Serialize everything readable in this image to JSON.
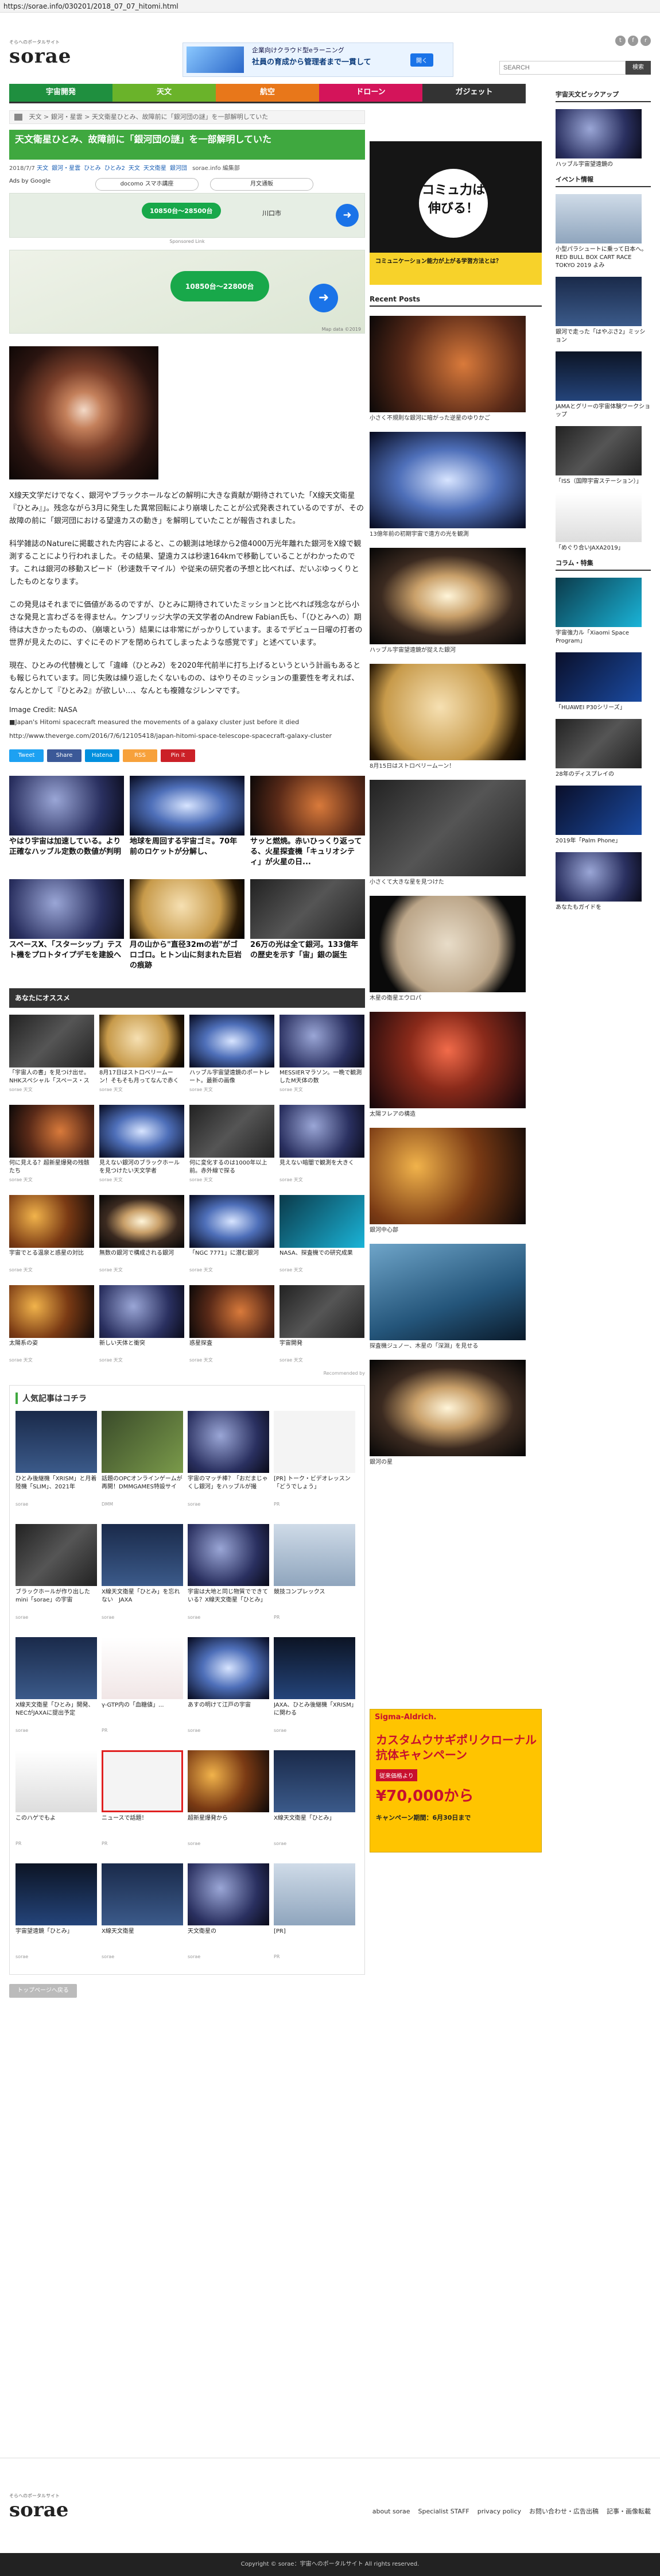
{
  "url": "https://sorae.info/030201/2018_07_07_hitomi.html",
  "site": {
    "tagline": "そらへのポータルサイト",
    "name": "sorae"
  },
  "top_ad": {
    "line1": "企業向けクラウド型eラーニング",
    "line2": "社員の育成から管理者まで一貫して",
    "button": "開く"
  },
  "search": {
    "placeholder": "SEARCH",
    "button": "検索"
  },
  "nav": [
    {
      "label": "宇宙開発",
      "color": "#1f8f3f"
    },
    {
      "label": "天文",
      "color": "#6ab32a"
    },
    {
      "label": "航空",
      "color": "#e8771a"
    },
    {
      "label": "ドローン",
      "color": "#d4145a"
    },
    {
      "label": "ガジェット",
      "color": "#333333"
    }
  ],
  "breadcrumb": [
    "天文",
    "銀河・星雲",
    "天文衛星ひとみ、故障前に「銀河団の謎」を一部解明していた"
  ],
  "article": {
    "title": "天文衛星ひとみ、故障前に「銀河団の謎」を一部解明していた",
    "date": "2018/7/7",
    "tags": [
      "天文",
      "銀河・星雲",
      "ひとみ",
      "ひとみ2",
      "天文",
      "天文衛星",
      "銀河団"
    ],
    "author": "sorae.info 編集部",
    "ads_label": "Ads by Google",
    "ads_pill1": "docomo スマホ講座",
    "ads_pill2": "月文通販",
    "map1": {
      "price": "10850台～28500台",
      "loc": "川口市"
    },
    "sponsored": "Sponsored Link",
    "map2": {
      "price": "10850台～22800台",
      "credit": "Map data ©2019"
    },
    "paragraphs": [
      "X線天文学だけでなく、銀河やブラックホールなどの解明に大きな貢献が期待されていた「X線天文衛星『ひとみ』」。残念ながら3月に発生した異常回転により崩壊したことが公式発表されているのですが、その故障の前に「銀河団における望遠カスの動き」を解明していたことが報告されました。",
      "科学雑誌のNatureに掲載された内容によると、この観測は地球から2億4000万光年離れた銀河をX線で観測することにより行われました。その結果、望遠カスは秒速164kmで移動していることがわかったのです。これは銀河の移動スピード（秒速数千マイル）や従来の研究者の予想と比べれば、だいぶゆっくりとしたものとなります。",
      "この発見はそれまでに価値があるのですが、ひとみに期待されていたミッションと比べれば残念ながら小さな発見と言わざるを得ません。ケンブリッジ大学の天文学者のAndrew Fabian氏も、「（ひとみへの）期待は大きかったものの、（崩壊という）結果には非常にがっかりしています。まるでデビュー日曜の打者の世界が見えたのに、すぐにそのドアを閉められてしまったような感覚です」と述べています。",
      "現在、ひとみの代替機として「違峰（ひとみ2）を2020年代前半に打ち上げるというという計画もあるとも報じられています。同じ失敗は繰り返したくないものの、はやりそのミッションの重要性を考えれば、なんとかして『ひとみ2』が欲しい…、なんとも複雑なジレンマです。"
    ],
    "image_credit": "Image Credit: NASA",
    "source_line1": "■Japan's Hitomi spacecraft measured the movements of a galaxy cluster just before it died",
    "source_line2": "http://www.theverge.com/2016/7/6/12105418/japan-hitomi-space-telescope-spacecraft-galaxy-cluster",
    "share": [
      {
        "label": "Tweet",
        "color": "#1da1f2"
      },
      {
        "label": "Share",
        "color": "#3b5998"
      },
      {
        "label": "Hatena",
        "color": "#008fde"
      },
      {
        "label": "RSS",
        "color": "#f7a13b"
      },
      {
        "label": "Pin it",
        "color": "#cb2027"
      }
    ]
  },
  "related6": [
    {
      "caption": "やはり宇宙は加速している。より正確なハッブル定数の数値が判明",
      "bg": "bg-space1"
    },
    {
      "caption": "地球を周回する宇宙ゴミ。70年前のロケットが分解し、",
      "bg": "bg-space5"
    },
    {
      "caption": "サッと燃焼。赤いひっくり返ってる、火星探査機「キュリオシティ」が火星の日...",
      "bg": "bg-space2"
    },
    {
      "caption": "スペースX、「スターシップ」テスト機をプロトタイプデモを建設へ",
      "bg": "bg-space1"
    },
    {
      "caption": "月の山から\"直径32mの岩\"がゴロゴロ。ヒトン山に刻まれた巨岩の痕跡",
      "bg": "bg-moon"
    },
    {
      "caption": "26万の光は全て銀河。133億年の歴史を示す「宙」銀の誕生",
      "bg": "bg-space7"
    }
  ],
  "recommend_title": "あなたにオススメ",
  "recommend": [
    {
      "caption": "「宇宙人の書」を見つけ出せ。NHKスペシャル「スペース・スペクタクル」",
      "by": "sorae 天文",
      "bg": "bg-space7"
    },
    {
      "caption": "8月17日はストロベリームーン！そもそも月ってなんで赤く",
      "by": "sorae 天文",
      "bg": "bg-moon"
    },
    {
      "caption": "ハッブル宇宙望遠鏡のポートレート。最新の画像",
      "by": "sorae 天文",
      "bg": "bg-space5"
    },
    {
      "caption": "MESSIERマラソン。一晩で観測したM天体の数",
      "by": "sorae 天文",
      "bg": "bg-space1"
    },
    {
      "caption": "何に見える？超新星爆発の残骸たち",
      "by": "sorae 天文",
      "bg": "bg-space2"
    },
    {
      "caption": "見えない銀河のブラックホールを見つけたい天文学者",
      "by": "sorae 天文",
      "bg": "bg-space5"
    },
    {
      "caption": "何に変化するのは1000年以上前。赤外線で探る",
      "by": "sorae 天文",
      "bg": "bg-space7"
    },
    {
      "caption": "見えない暗闇で観測を大きく",
      "by": "sorae 天文",
      "bg": "bg-space1"
    },
    {
      "caption": "宇宙でとる温泉と惑星の対比",
      "by": "sorae 天文",
      "bg": "bg-space6"
    },
    {
      "caption": "無数の銀河で構成される銀河",
      "by": "sorae 天文",
      "bg": "bg-galaxy"
    },
    {
      "caption": "「NGC 7771」に潜む銀河",
      "by": "sorae 天文",
      "bg": "bg-space5"
    },
    {
      "caption": "NASA、探査機での研究成果",
      "by": "sorae 天文",
      "bg": "bg-cyan"
    },
    {
      "caption": "太陽系の姿",
      "by": "sorae 天文",
      "bg": "bg-space6"
    },
    {
      "caption": "新しい天体と衝突",
      "by": "sorae 天文",
      "bg": "bg-space1"
    },
    {
      "caption": "惑星探査",
      "by": "sorae 天文",
      "bg": "bg-space2"
    },
    {
      "caption": "宇宙開発",
      "by": "sorae 天文",
      "bg": "bg-space7"
    }
  ],
  "powered": "Recommended by",
  "popular_title": "人気記事はコチラ",
  "popular": [
    {
      "caption": "ひとみ後継機「XRISM」と月着陸機「SLIM」、2021年",
      "src": "sorae",
      "bg": "bg-sat"
    },
    {
      "caption": "話題のOPCオンラインゲームが再開！DMMGAMES特設サイ",
      "src": "DMM",
      "bg": "bg-green"
    },
    {
      "caption": "宇宙のマッチ棒？「おだまじゃくし銀河」をハッブルが撮",
      "src": "sorae",
      "bg": "bg-space1"
    },
    {
      "caption": "[PR] トーク・ビデオレッスン「どうでしょう」",
      "src": "PR",
      "bg": "bg-white"
    },
    {
      "caption": "ブラックホールが作り出したmini「sorae」の宇宙",
      "src": "sorae",
      "bg": "bg-space7"
    },
    {
      "caption": "X線天文衛星「ひとみ」を忘れない　JAXA",
      "src": "sorae",
      "bg": "bg-sat"
    },
    {
      "caption": "宇宙は大地と同じ物質でできている？X線天文衛星「ひとみ」",
      "src": "sorae",
      "bg": "bg-space1"
    },
    {
      "caption": "競技コンプレックス",
      "src": "PR",
      "bg": "bg-people"
    },
    {
      "caption": "X線天文衛星「ひとみ」開発、NECがJAXAに提出予定",
      "src": "sorae",
      "bg": "bg-sat"
    },
    {
      "caption": "γ-GTP内の「血糖値」...",
      "src": "PR",
      "bg": "bg-red"
    },
    {
      "caption": "あすの明けて江戸の宇宙",
      "src": "sorae",
      "bg": "bg-space5"
    },
    {
      "caption": "JAXA、ひとみ後継機「XRISM」に関わる",
      "src": "sorae",
      "bg": "bg-sat2"
    },
    {
      "caption": "このハゲでもよ",
      "src": "PR",
      "bg": "bg-japan"
    },
    {
      "caption": "ニュースで話題！",
      "src": "PR",
      "bg": "bg-white"
    },
    {
      "caption": "超新星爆発から",
      "src": "sorae",
      "bg": "bg-space6"
    },
    {
      "caption": "X線天文衛星「ひとみ」",
      "src": "sorae",
      "bg": "bg-sat"
    },
    {
      "caption": "宇宙望遠鏡「ひとみ」",
      "src": "sorae",
      "bg": "bg-sat2"
    },
    {
      "caption": "X線天文衛星",
      "src": "sorae",
      "bg": "bg-sat"
    },
    {
      "caption": "天文衛星の",
      "src": "sorae",
      "bg": "bg-space1"
    },
    {
      "caption": "[PR]",
      "src": "PR",
      "bg": "bg-people"
    }
  ],
  "totop": "トップページへ戻る",
  "comic_ad": {
    "bubble": "コミュ力は伸びる！",
    "bottom": "コミュニケーション能力が上がる学習方法とは？"
  },
  "recent_title": "Recent Posts",
  "recent": [
    {
      "caption": "小さく不規則な銀河に暗がった逆星のゆりかご",
      "bg": "bg-space2"
    },
    {
      "caption": "13億年前の初期宇宙で遠方の光を観測",
      "bg": "bg-space5"
    },
    {
      "caption": "ハッブル宇宙望遠鏡が捉えた銀河",
      "bg": "bg-galaxy"
    },
    {
      "caption": "8月15日はストロベリームーン！",
      "bg": "bg-moon"
    },
    {
      "caption": "小さくて大きな星を見つけた",
      "bg": "bg-space7"
    },
    {
      "caption": "木星の衛星エウロパ",
      "bg": "bg-planet"
    },
    {
      "caption": "太陽フレアの構造",
      "bg": "bg-nebula"
    },
    {
      "caption": "銀河中心部",
      "bg": "bg-space6"
    },
    {
      "caption": "探査機ジュノー、木星の「深淵」を見せる",
      "bg": "bg-ocean"
    },
    {
      "caption": "銀河の星",
      "bg": "bg-galaxy"
    }
  ],
  "pickup_title": "宇宙天文ピックアップ",
  "pickup": [
    {
      "caption": "ハッブル宇宙望遠鏡の",
      "date": "",
      "bg": "bg-space1"
    }
  ],
  "event_title": "イベント情報",
  "events": [
    {
      "caption": "小型パラシュートに乗って日本へ。RED BULL BOX CART RACE TOKYO 2019 よみ",
      "date": "",
      "bg": "bg-people"
    },
    {
      "caption": "銀河で走った「はやぶさ2」ミッション",
      "date": "",
      "bg": "bg-sat"
    },
    {
      "caption": "JAMAとグリーの宇宙体験ワークショップ",
      "date": "",
      "bg": "bg-sat2"
    },
    {
      "caption": "「ISS（国際宇宙ステーション）」",
      "date": "",
      "bg": "bg-space7"
    },
    {
      "caption": "「めぐり合いJAXA2019」",
      "date": "",
      "bg": "bg-japan"
    }
  ],
  "column_title": "コラム・特集",
  "columns": [
    {
      "caption": "宇宙強力ル「Xiaomi Space Program」",
      "date": "",
      "bg": "bg-cyan"
    },
    {
      "caption": "「HUAWEI P30シリーズ」",
      "date": "",
      "bg": "bg-phone"
    },
    {
      "caption": "28年のディスプレイの",
      "date": "",
      "bg": "bg-space7"
    },
    {
      "caption": "2019年「Palm Phone」",
      "date": "",
      "bg": "bg-phone"
    },
    {
      "caption": "あなたもガイドを",
      "date": "",
      "bg": "bg-space1"
    }
  ],
  "big_ad": {
    "brand": "Sigma-Aldrich.",
    "title": "カスタムウサギポリクローナル抗体キャンペーン",
    "badge": "従来価格より",
    "price": "¥70,000から",
    "note": "キャンペーン期間：6月30日まで"
  },
  "footer": {
    "tagline": "そらへのポータルサイト",
    "name": "sorae",
    "links": [
      "about sorae",
      "Specialist STAFF",
      "privacy policy",
      "お問い合わせ・広告出稿",
      "記事・画像転載"
    ],
    "copyright": "Copyright © sorae：宇宙へのポータルサイト All rights reserved."
  }
}
